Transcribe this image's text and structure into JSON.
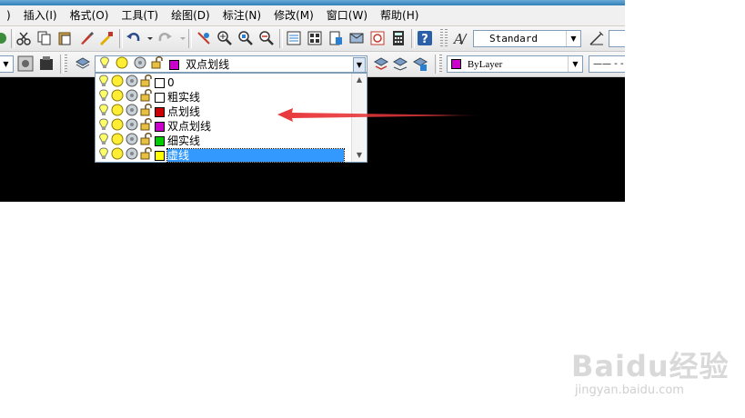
{
  "menubar": {
    "items": [
      ")",
      "插入(I)",
      "格式(O)",
      "工具(T)",
      "绘图(D)",
      "标注(N)",
      "修改(M)",
      "窗口(W)",
      "帮助(H)"
    ]
  },
  "toolbar1": {
    "text_style": "Standard"
  },
  "toolbar2": {
    "layer_combo": {
      "value": "双点划线",
      "swatch": "#cc00cc"
    },
    "color_combo": {
      "value": "ByLayer",
      "swatch": "#cc00cc"
    },
    "linetype_text": "—— - -"
  },
  "layer_dropdown": {
    "items": [
      {
        "name": "0",
        "color": "#ffffff"
      },
      {
        "name": "粗实线",
        "color": "#ffffff"
      },
      {
        "name": "点划线",
        "color": "#cc0000"
      },
      {
        "name": "双点划线",
        "color": "#cc00cc"
      },
      {
        "name": "细实线",
        "color": "#00cc00"
      },
      {
        "name": "虚线",
        "color": "#ffff00"
      }
    ],
    "selected_index": 5
  },
  "annotation": {
    "arrow_color": "#e8383b"
  },
  "watermark": {
    "logo": "Baidu经验",
    "url": "jingyan.baidu.com"
  }
}
